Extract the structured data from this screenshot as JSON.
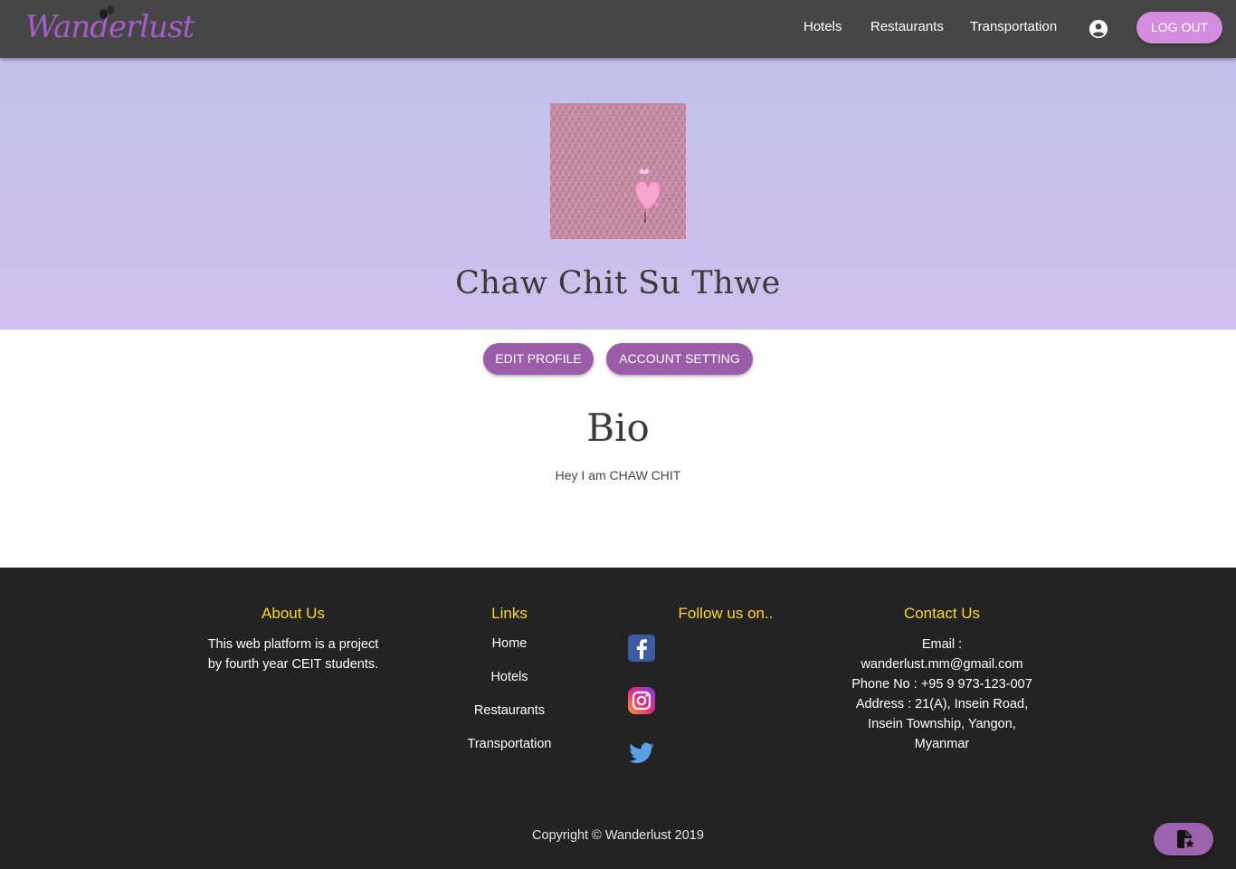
{
  "brand": {
    "logo_text": "Wanderlust"
  },
  "nav": {
    "links": [
      "Hotels",
      "Restaurants",
      "Transportation"
    ],
    "logout_label": "LOG OUT"
  },
  "profile": {
    "name": "Chaw Chit Su Thwe",
    "edit_label": "EDIT PROFILE",
    "account_label": "ACCOUNT SETTING",
    "bio_title": "Bio",
    "bio_text": "Hey I am CHAW CHIT"
  },
  "footer": {
    "about_title": "About Us",
    "about_lines": [
      "This web platform is a project",
      "by fourth year CEIT students."
    ],
    "links_title": "Links",
    "links": [
      "Home",
      "Hotels",
      "Restaurants",
      "Transportation"
    ],
    "follow_title": "Follow us on..",
    "social": [
      "facebook-icon",
      "instagram-icon",
      "twitter-icon"
    ],
    "contact_title": "Contact Us",
    "contact_lines": [
      "Email :",
      "wanderlust.mm@gmail.com",
      "Phone No : +95 9 973-123-007",
      "Address : 21(A), Insein Road,",
      "Insein Township, Yangon,",
      "Myanmar"
    ],
    "copyright": "Copyright © Wanderlust 2019"
  },
  "colors": {
    "navbar": "#464646",
    "hero_start": "#c3c0ec",
    "hero_end": "#cec0ec",
    "button_purple": "#9b5ca8",
    "logout_pink": "#d28ddf",
    "footer_bg": "#232323",
    "footer_heading": "#ffd62e"
  }
}
